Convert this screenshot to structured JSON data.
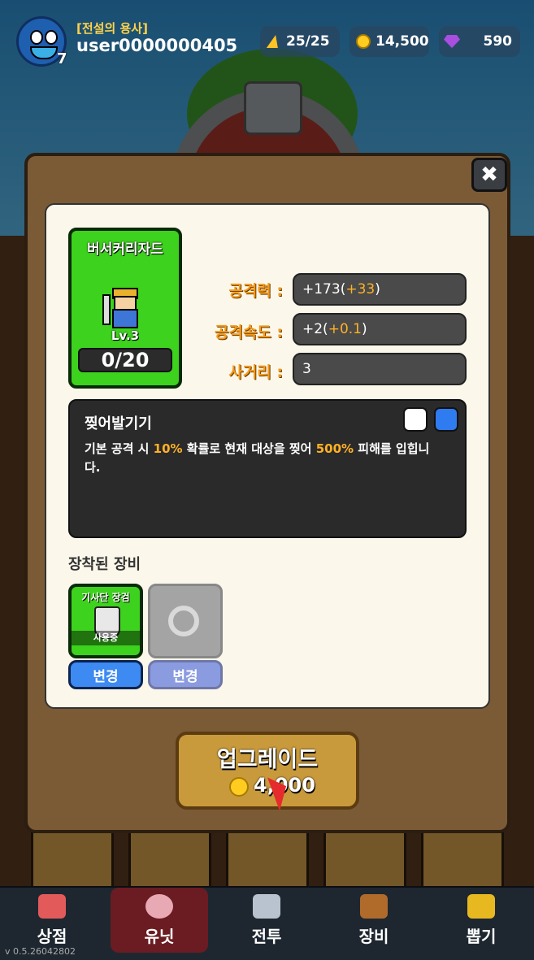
{
  "header": {
    "player_level": "7",
    "title": "[전설의 용사]",
    "username": "user0000000405",
    "energy": "25/25",
    "coins": "14,500",
    "gems": "590"
  },
  "unit": {
    "name": "버서커리자드",
    "level": "Lv.3",
    "progress": "0/20",
    "rarity_color": "#3dd21d"
  },
  "stats": [
    {
      "label": "공격력 :",
      "base": "+173(",
      "bonus": "+33",
      "close": ")"
    },
    {
      "label": "공격속도 :",
      "base": "+2(",
      "bonus": "+0.1",
      "close": ")"
    },
    {
      "label": "사거리 :",
      "base": "3",
      "bonus": "",
      "close": ""
    }
  ],
  "skill": {
    "name": "찢어발기기",
    "desc_parts": [
      "기본 공격 시 ",
      "10%",
      " 확률로 현재 대상을 찢어 ",
      "500%",
      " 피해를 입힙니다."
    ]
  },
  "equipment": {
    "title": "장착된 장비",
    "slot1_name": "기사단 장검",
    "slot1_status": "사용중",
    "change_label": "변경"
  },
  "upgrade": {
    "label": "업그레이드",
    "cost": "4,000"
  },
  "nav": [
    {
      "label": "상점",
      "icon": "shop-icon"
    },
    {
      "label": "유닛",
      "icon": "unit-icon"
    },
    {
      "label": "전투",
      "icon": "battle-icon"
    },
    {
      "label": "장비",
      "icon": "equipment-icon"
    },
    {
      "label": "뽑기",
      "icon": "gacha-icon"
    }
  ],
  "version": "v 0.5.26042802",
  "colors": {
    "accent_orange": "#f39a1a",
    "button_blue": "#3c8af2",
    "panel_bg": "#fbf7ea",
    "modal_bg": "#7b5a36"
  }
}
